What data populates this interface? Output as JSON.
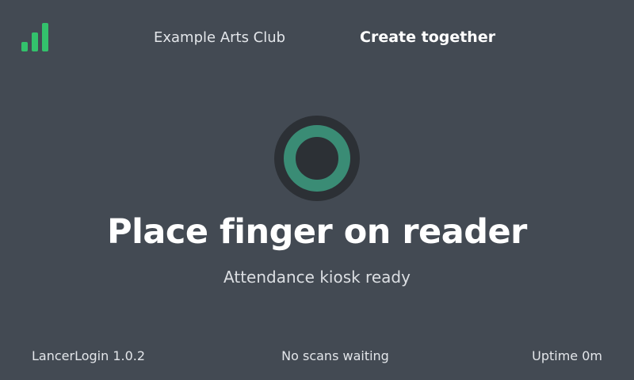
{
  "header": {
    "club_name": "Example Arts Club",
    "tagline": "Create together",
    "signal_icon": "signal-bars-icon",
    "signal_color": "#33c26c"
  },
  "status": {
    "indicator_icon": "fingerprint-ring-icon",
    "ring_color": "#3a8c75",
    "headline": "Place finger on reader",
    "subline": "Attendance kiosk ready"
  },
  "footer": {
    "app_version": "LancerLogin 1.0.2",
    "queue_status": "No scans waiting",
    "uptime": "Uptime 0m"
  }
}
